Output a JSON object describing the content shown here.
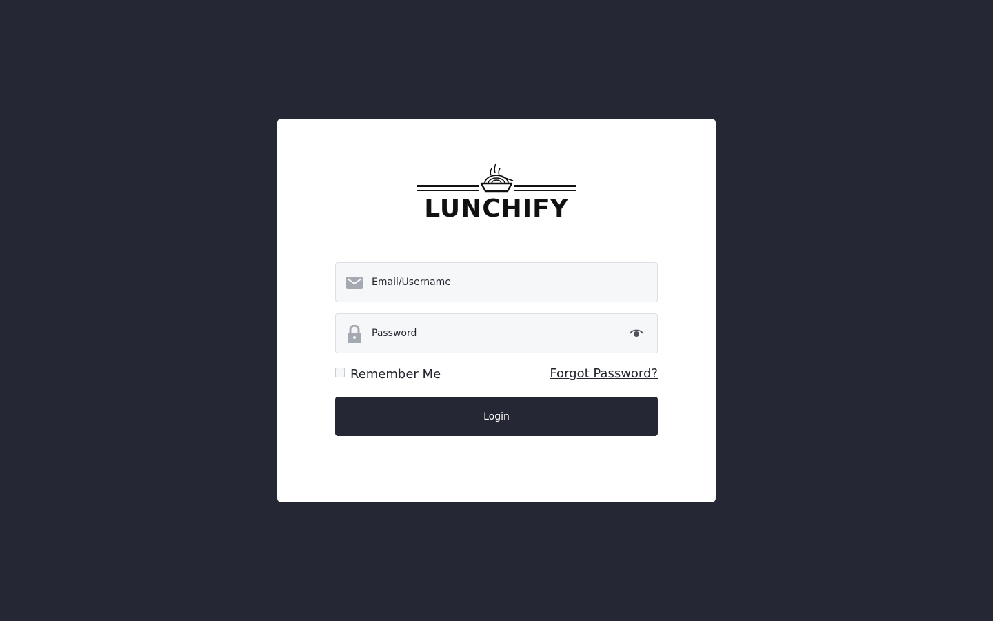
{
  "brand": {
    "name": "LUNCHIFY"
  },
  "login_form": {
    "email_placeholder": "Email/Username",
    "password_placeholder": "Password",
    "remember_label": "Remember Me",
    "forgot_label": "Forgot Password?",
    "login_label": "Login"
  },
  "icons": {
    "email": "envelope-icon",
    "password": "lock-icon",
    "toggle": "eye-icon"
  },
  "colors": {
    "background": "#252734",
    "card": "#ffffff",
    "button": "#252734",
    "input_bg": "#f6f7f9",
    "icon": "#a5a9b1"
  }
}
